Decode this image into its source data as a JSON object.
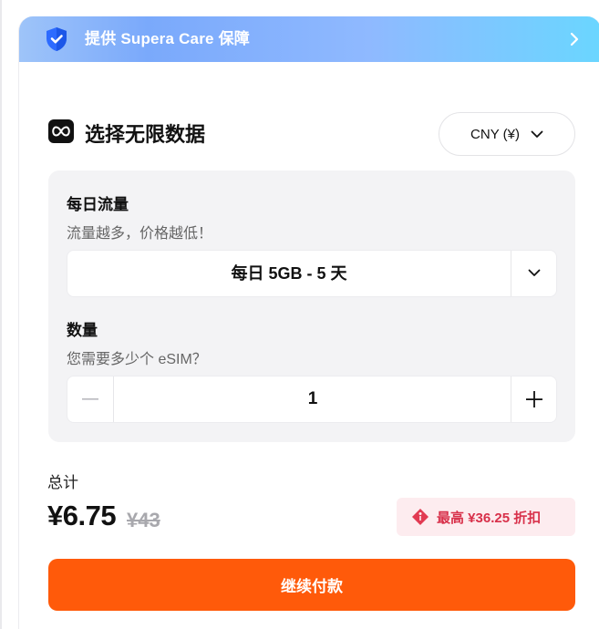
{
  "banner": {
    "text": "提供 Supera Care 保障",
    "icon": "shield-check-icon",
    "chevron": "chevron-right-icon"
  },
  "section": {
    "title": "选择无限数据",
    "icon": "infinity-icon"
  },
  "currency": {
    "label": "CNY (¥)",
    "icon": "chevron-down-icon"
  },
  "daily_data": {
    "label": "每日流量",
    "hint": "流量越多，价格越低！",
    "selected": "每日 5GB - 5 天"
  },
  "quantity": {
    "label": "数量",
    "hint": "您需要多少个 eSIM？",
    "value": "1",
    "minus": "minus-icon",
    "plus": "plus-icon"
  },
  "totals": {
    "label": "总计",
    "price": "¥6.75",
    "original_price": "¥43",
    "discount": "最高 ¥36.25 折扣"
  },
  "actions": {
    "continue": "继续付款"
  },
  "colors": {
    "accent": "#ff5a0a",
    "discount_text": "#d8304a",
    "discount_bg": "#fdecef",
    "panel_bg": "#f3f3f5"
  }
}
